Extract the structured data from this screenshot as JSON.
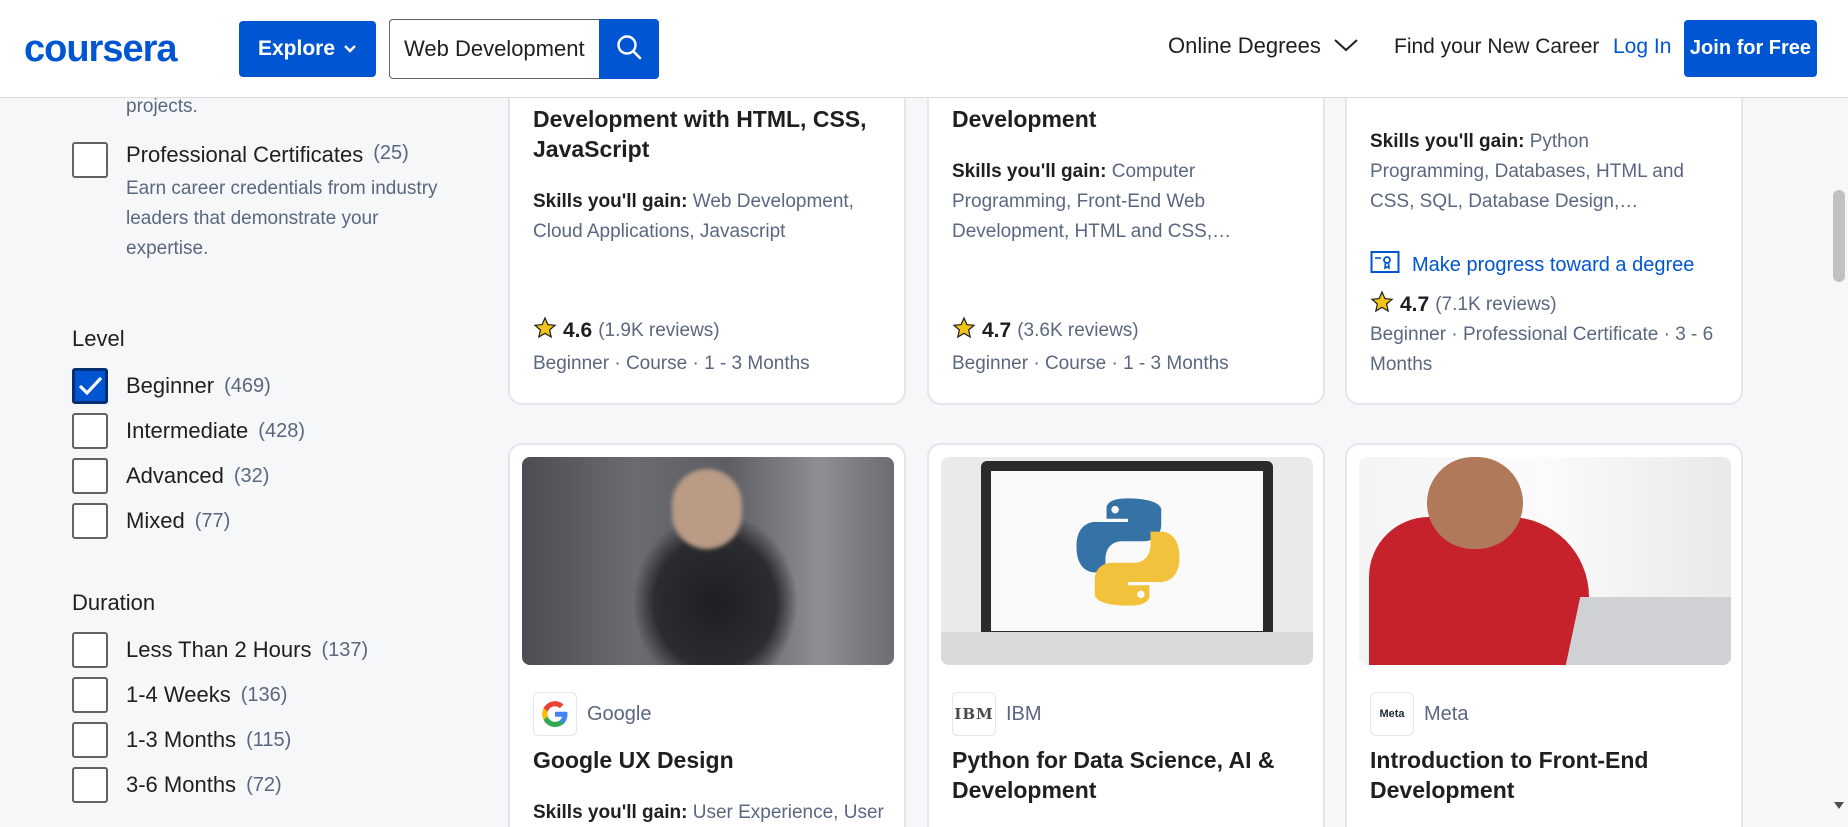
{
  "header": {
    "logo": "coursera",
    "explore_label": "Explore",
    "search_value": "Web Development",
    "nav_degrees": "Online Degrees",
    "nav_career": "Find your New Career",
    "login": "Log In",
    "join": "Join for Free"
  },
  "sidebar": {
    "top_desc": "projects.",
    "prof_cert": {
      "label": "Professional Certificates",
      "count": "(25)",
      "desc": [
        "Earn career credentials from industry",
        "leaders that demonstrate your",
        "expertise."
      ]
    },
    "level": {
      "heading": "Level",
      "options": [
        {
          "label": "Beginner",
          "count": "(469)",
          "checked": true
        },
        {
          "label": "Intermediate",
          "count": "(428)",
          "checked": false
        },
        {
          "label": "Advanced",
          "count": "(32)",
          "checked": false
        },
        {
          "label": "Mixed",
          "count": "(77)",
          "checked": false
        }
      ]
    },
    "duration": {
      "heading": "Duration",
      "options": [
        {
          "label": "Less Than 2 Hours",
          "count": "(137)"
        },
        {
          "label": "1-4 Weeks",
          "count": "(136)"
        },
        {
          "label": "1-3 Months",
          "count": "(115)"
        },
        {
          "label": "3-6 Months",
          "count": "(72)"
        }
      ]
    }
  },
  "cards_top": [
    {
      "title_lines": [
        "Development with HTML, CSS,",
        "JavaScript"
      ],
      "skills_label": "Skills you'll gain:",
      "skills_lines": [
        "Web Development,",
        "Cloud Applications, Javascript"
      ],
      "rating": "4.6",
      "reviews": "(1.9K reviews)",
      "meta": "Beginner · Course · 1 - 3 Months"
    },
    {
      "title_lines": [
        "Development"
      ],
      "skills_label": "Skills you'll gain:",
      "skills_lines": [
        "Computer",
        "Programming, Front-End Web",
        "Development, HTML and CSS,…"
      ],
      "rating": "4.7",
      "reviews": "(3.6K reviews)",
      "meta": "Beginner · Course · 1 - 3 Months"
    },
    {
      "skills_label": "Skills you'll gain:",
      "skills_lines": [
        "Python",
        "Programming, Databases, HTML and",
        "CSS, SQL, Database Design,…"
      ],
      "degree_link": "Make progress toward a degree",
      "rating": "4.7",
      "reviews": "(7.1K reviews)",
      "meta_lines": [
        "Beginner · Professional Certificate · 3 - 6",
        "Months"
      ]
    }
  ],
  "cards_bottom": [
    {
      "partner": "Google",
      "title_lines": [
        "Google UX Design"
      ],
      "skills_label": "Skills you'll gain:",
      "skills_lines": [
        "User Experience, User"
      ]
    },
    {
      "partner": "IBM",
      "partner_logo_text": "IBM",
      "title_lines": [
        "Python for Data Science, AI &",
        "Development"
      ]
    },
    {
      "partner": "Meta",
      "partner_logo_text": "Meta",
      "title_lines": [
        "Introduction to Front-End",
        "Development"
      ]
    }
  ],
  "colors": {
    "brand": "#0056d2",
    "star": "#f0c419",
    "muted": "#5b6780"
  },
  "icons": {
    "search": "search-icon",
    "star": "star-icon",
    "degree": "degree-icon",
    "chevron": "chevron-down-icon"
  }
}
